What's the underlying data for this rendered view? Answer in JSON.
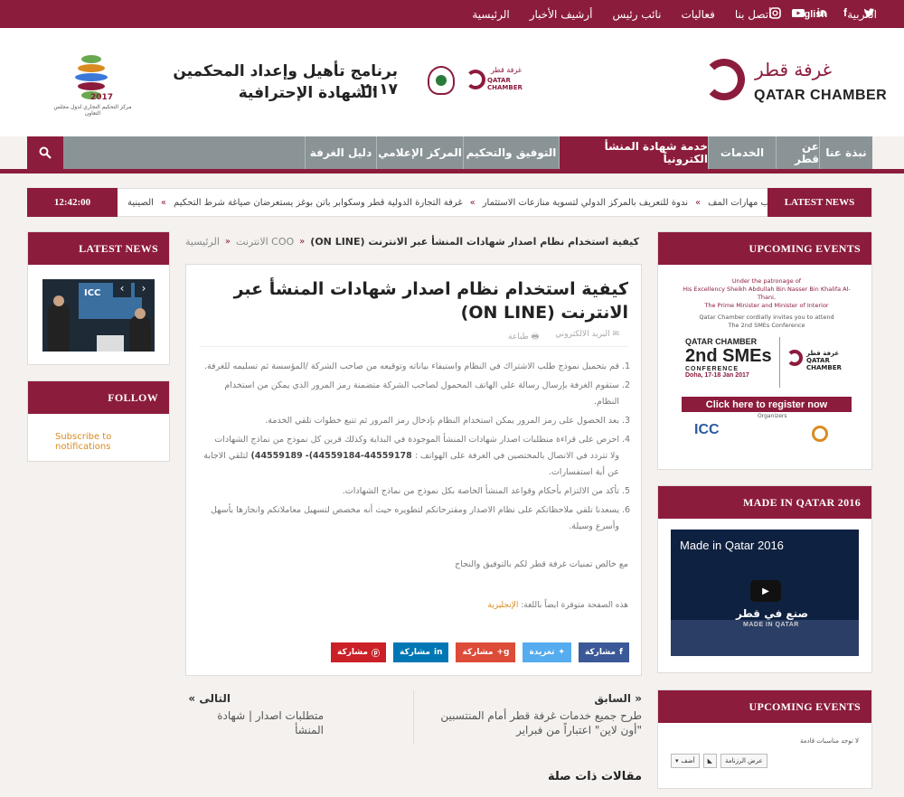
{
  "colors": {
    "brand": "#8c1c3c",
    "nav_gray": "#8a9496",
    "accent_orange": "#d98b20"
  },
  "topbar": {
    "links": [
      "الرئيسية",
      "أرشيف الأخبار",
      "نائب رئيس",
      "فعاليات",
      "أتصل بنا",
      "English",
      "العربية"
    ],
    "social_icons": [
      "twitter-icon",
      "facebook-icon",
      "linkedin-icon",
      "youtube-icon",
      "instagram-icon"
    ]
  },
  "header": {
    "logo_ar": "غرفة قطر",
    "logo_en": "QATAR CHAMBER",
    "mini_logo_ar": "غرفة قطر",
    "mini_logo_en": "QATAR CHAMBER",
    "program_title_1": "برنامج تأهيل وإعداد المحكمين ٢٠١٧",
    "program_title_2": "الشهادة الإحترافية",
    "arbitration_year": "2017",
    "arbitration_caption": "مركز التحكيم التجاري لدول مجلس التعاون"
  },
  "nav": {
    "items": [
      "نبذة عنا",
      "عن قطر",
      "الخدمات",
      "خدمة شهادة المنشأ الكترونياً",
      "التوفيق والتحكيم",
      "المركز الإعلامي",
      "دليل الغرفة"
    ],
    "active_index": 3,
    "search_icon": "search-icon"
  },
  "ticker": {
    "label": "LATEST NEWS",
    "time": "12:42:00",
    "items": [
      "الصينية",
      "غرفة التجارة الدولية قطر وسكوابر باتن بوغز يستعرضان صياغة شرط التحكيم",
      "ندوة للتعريف بالمركز الدولي لتسوية منازعات الاستثمار",
      "اكتساب مهارات المف"
    ]
  },
  "left": {
    "latest_news_title": "LATEST NEWS",
    "slider_prev": "‹",
    "slider_next": "›",
    "follow_title": "FOLLOW",
    "subscribe_text": "Subscribe to notifications"
  },
  "breadcrumb": {
    "home": "الرئيسية",
    "section": "COO الانترنت",
    "current": "كيفية استخدام نظام اصدار شهادات المنشأ عبر الانترنت (ON LINE)"
  },
  "article": {
    "title": "كيفية استخدام نظام اصدار شهادات المنشأ عبر الانترنت (ON LINE)",
    "print_label": "طباعة",
    "email_label": "البريد الالكتروني",
    "steps": [
      "قم بتحميل نموذج طلب الاشتراك في النظام واستيفاء بياناته وتوقيعه من صاحب الشركة /المؤسسة ثم تسليمه للغرفة.",
      "ستقوم الغرفة بإرسال رسالة على الهاتف المحمول لصاحب الشركة متضمنة رمز المرور الذي يمكن من استخدام النظام.",
      "بعد الحصول على رمز المرور يمكن استخدام النظام بإدخال رمز المرور ثم تتبع خطوات تلقي الخدمة.",
      "احرص على قراءة منطلبات اصدار شهادات المنشأ الموجودة في البداية وكذلك قرين كل نموذج من نماذج الشهادات ولا تتردد في الاتصال بالمختصين في الغرفة على الهواتف :",
      "تأكد من الالتزام بأحكام وقواعد المنشأ الخاصة بكل نموذج من نماذج الشهادات.",
      "يسعدنا تلقي ملاحظاتكم على نظام الاصدار ومقترحاتكم لتطويره حيث أنه مخصص لتسهيل معاملاتكم وانجازها بأسهل وأسرع وسيلة."
    ],
    "phones": "44559178-44559184)-",
    "phones_2": "44559189)",
    "phones_suffix": "لتلقي الاجابة عن أية استفسارات.",
    "thanks": "مع خالص تمنيات غرفة قطر لكم بالتوفيق والنجاح",
    "lang_prefix": "هذه الصفحة متوفرة ايضاً باللغة:",
    "lang_link": "الإنجليزية"
  },
  "shares": [
    {
      "label": "مشاركة",
      "icon": "facebook-icon",
      "color": "#3b5998"
    },
    {
      "label": "تغريدة",
      "icon": "twitter-icon",
      "color": "#55acee"
    },
    {
      "label": "مشاركة",
      "icon": "google-plus-icon",
      "color": "#dd4b39"
    },
    {
      "label": "مشاركة",
      "icon": "linkedin-icon",
      "color": "#0077b5"
    },
    {
      "label": "مشاركة",
      "icon": "pinterest-icon",
      "color": "#cb2027"
    }
  ],
  "prev": {
    "label": "السابق",
    "title": "طرح جميع خدمات غرفة قطر أمام المنتسبين \"أون لاين\" اعتباراً من فبراير"
  },
  "next": {
    "label": "التالى",
    "title": "متطلبات اصدار | شهادة المنشأ"
  },
  "related_title": "مقالات ذات صلة",
  "right": {
    "upcoming_title": "UPCOMING EVENTS",
    "event_patron": "Under the patronage of",
    "event_sheikh": "His Excellency Sheikh Abdullah Bin Nasser Bin Khalifa Al-Thani,",
    "event_pm": "The Prime Minister and Minister of Interior",
    "event_invite": "Qatar Chamber cordially invites you to attend",
    "event_conf": "The 2nd SMEs Conference",
    "event_qc": "QATAR CHAMBER",
    "event_big": "2nd SMEs",
    "event_conference": "CONFERENCE",
    "event_dates": "Doha, 17-18 Jan 2017",
    "event_side_ar": "غرفة قطر",
    "event_side_en": "QATAR CHAMBER",
    "register_text": "Click here to register now",
    "organizers": "Organizers",
    "icc": "ICC",
    "made_in_qatar_title": "MADE IN QATAR 2016",
    "video_title": "Made in Qatar 2016",
    "video_logo_ar": "صنع في قطر",
    "video_logo_en": "MADE IN QATAR",
    "upcoming2_title": "UPCOMING EVENTS",
    "no_events": "لا توجد مناسبات قادمة",
    "btn_calendar": "عرض الرزنامة",
    "btn_prev": "أضف"
  }
}
